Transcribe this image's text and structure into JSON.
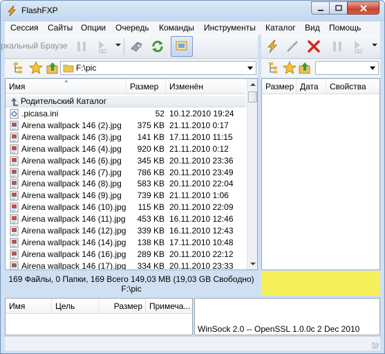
{
  "window": {
    "title": "FlashFXP"
  },
  "menu": [
    "Сессия",
    "Сайты",
    "Опции",
    "Очередь",
    "Команды",
    "Инструменты",
    "Каталог",
    "Вид",
    "Помощь"
  ],
  "left_toolbar": {
    "quickconnect_text": "ркальный Браузе"
  },
  "left_address": {
    "path": "F:\\pic"
  },
  "right_address": {
    "path": ""
  },
  "left_columns": {
    "name": "Имя",
    "size": "Размер",
    "modified": "Изменён"
  },
  "right_columns": {
    "size": "Размер",
    "date": "Дата",
    "properties": "Свойства"
  },
  "parent_row": {
    "label": "Родительский Каталог"
  },
  "files": [
    {
      "name": ".picasa.ini",
      "size": "52",
      "date": "10.12.2010 19:24",
      "type": "ini"
    },
    {
      "name": "Airena wallpack 146 (2).jpg",
      "size": "375 KB",
      "date": "21.11.2010 0:17",
      "type": "jpg"
    },
    {
      "name": "Airena wallpack 146 (3).jpg",
      "size": "141 KB",
      "date": "17.11.2010 11:15",
      "type": "jpg"
    },
    {
      "name": "Airena wallpack 146 (4).jpg",
      "size": "920 KB",
      "date": "21.11.2010 0:12",
      "type": "jpg"
    },
    {
      "name": "Airena wallpack 146 (6).jpg",
      "size": "345 KB",
      "date": "20.11.2010 23:36",
      "type": "jpg"
    },
    {
      "name": "Airena wallpack 146 (7).jpg",
      "size": "786 KB",
      "date": "20.11.2010 23:49",
      "type": "jpg"
    },
    {
      "name": "Airena wallpack 146 (8).jpg",
      "size": "583 KB",
      "date": "20.11.2010 22:04",
      "type": "jpg"
    },
    {
      "name": "Airena wallpack 146 (9).jpg",
      "size": "739 KB",
      "date": "21.11.2010 1:06",
      "type": "jpg"
    },
    {
      "name": "Airena wallpack 146 (10).jpg",
      "size": "115 KB",
      "date": "20.11.2010 22:09",
      "type": "jpg"
    },
    {
      "name": "Airena wallpack 146 (11).jpg",
      "size": "453 KB",
      "date": "16.11.2010 12:46",
      "type": "jpg"
    },
    {
      "name": "Airena wallpack 146 (12).jpg",
      "size": "339 KB",
      "date": "16.11.2010 12:43",
      "type": "jpg"
    },
    {
      "name": "Airena wallpack 146 (14).jpg",
      "size": "138 KB",
      "date": "17.11.2010 10:48",
      "type": "jpg"
    },
    {
      "name": "Airena wallpack 146 (16).jpg",
      "size": "289 KB",
      "date": "20.11.2010 22:12",
      "type": "jpg"
    },
    {
      "name": "Airena wallpack 146 (17).jpg",
      "size": "334 KB",
      "date": "20.11.2010 23:33",
      "type": "jpg"
    }
  ],
  "status": {
    "summary": "169 Файлы, 0 Папки, 169 Всего 149,03 MB (19,03 GB Свободно)",
    "path": "F:\\pic",
    "right_color": "#f5f05a"
  },
  "queue_columns": {
    "name": "Имя",
    "target": "Цель",
    "size": "Размер",
    "note": "Примеча..."
  },
  "log": {
    "line": "WinSock 2.0 -- OpenSSL 1.0.0c 2 Dec 2010"
  },
  "icons": {
    "app": "flashfxp-bolt-icon",
    "quickconnect": "quickconnect-icon",
    "pause": "pause-icon",
    "play": "play-transfer-icon",
    "sites": "site-manager-icon",
    "refresh": "refresh-icon",
    "mirror": "mirror-browse-icon",
    "connect": "connect-bolt-icon",
    "disconnect": "disconnect-icon",
    "abort": "abort-x-icon",
    "tree": "folder-tree-icon",
    "favorites": "favorites-star-icon",
    "parent": "parent-folder-icon",
    "folder": "folder-icon"
  }
}
